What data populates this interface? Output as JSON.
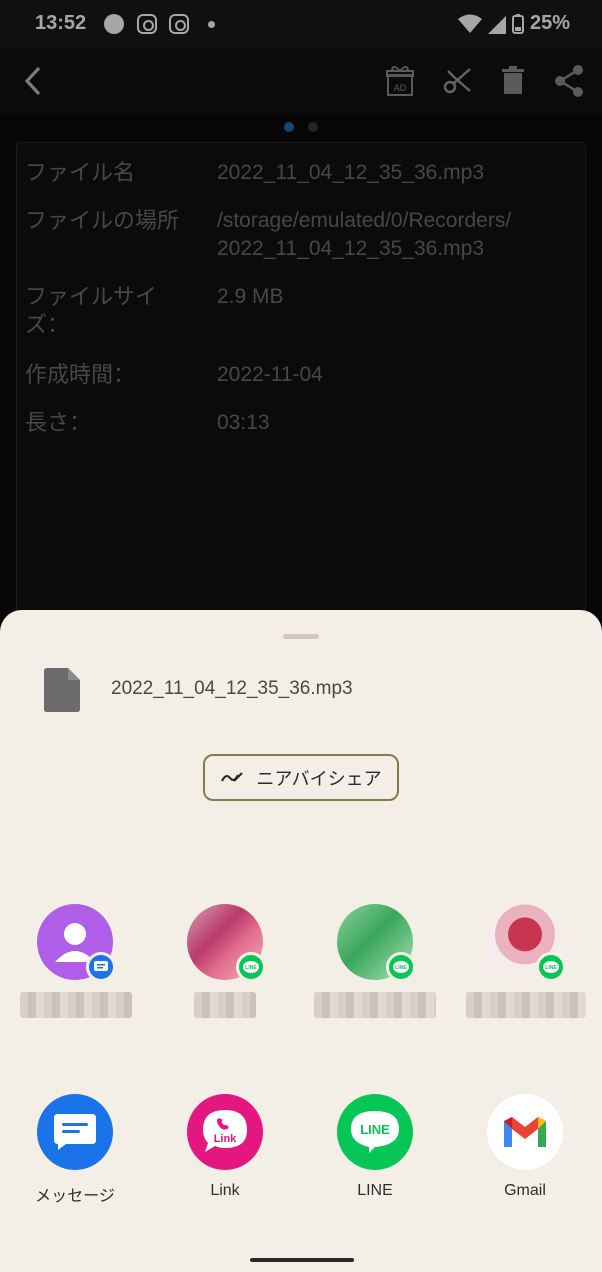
{
  "status_bar": {
    "time": "13:52",
    "battery": "25%"
  },
  "toolbar": {
    "icons": [
      "back-arrow-icon",
      "gift-ad-icon",
      "scissors-icon",
      "trash-icon",
      "share-icon"
    ],
    "ad_badge": "AD"
  },
  "file_info": {
    "rows": [
      {
        "label": "ファイル名",
        "value": "2022_11_04_12_35_36.mp3"
      },
      {
        "label": "ファイルの場所",
        "value": "/storage/emulated/0/Recorders/ 2022_11_04_12_35_36.mp3"
      },
      {
        "label": "ファイルサイズ：",
        "value": "2.9 MB"
      },
      {
        "label": "作成時間：",
        "value": "2022-11-04"
      },
      {
        "label": "長さ：",
        "value": "03:13"
      }
    ]
  },
  "share_sheet": {
    "file_name": "2022_11_04_12_35_36.mp3",
    "nearby_share_label": "ニアバイシェア",
    "apps": [
      {
        "label": "メッセージ",
        "icon": "messages-icon"
      },
      {
        "label": "Link",
        "icon": "link-app-icon",
        "icon_text": "Link"
      },
      {
        "label": "LINE",
        "icon": "line-app-icon",
        "icon_text": "LINE"
      },
      {
        "label": "Gmail",
        "icon": "gmail-icon"
      }
    ],
    "line_badge_text": "LINE"
  },
  "colors": {
    "sheet_bg": "#f4efe6",
    "line_green": "#06c755",
    "messages_blue": "#1a73e8",
    "link_pink": "#e3177f",
    "contact_purple": "#b05de8"
  }
}
